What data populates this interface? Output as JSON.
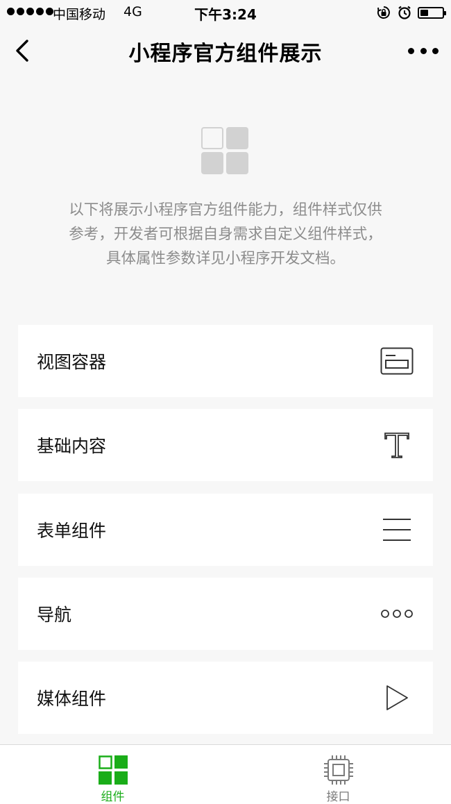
{
  "status_bar": {
    "carrier": "中国移动",
    "network": "4G",
    "time": "下午3:24",
    "battery_level": 0.35
  },
  "nav": {
    "title": "小程序官方组件展示"
  },
  "intro": {
    "lines": [
      "以下将展示小程序官方组件能力，组件样式仅供",
      "参考，开发者可根据自身需求自定义组件样式，",
      "具体属性参数详见小程序开发文档。"
    ]
  },
  "menu": {
    "items": [
      {
        "label": "视图容器",
        "icon": "view-container-icon"
      },
      {
        "label": "基础内容",
        "icon": "text-t-icon"
      },
      {
        "label": "表单组件",
        "icon": "three-lines-icon"
      },
      {
        "label": "导航",
        "icon": "three-circles-icon"
      },
      {
        "label": "媒体组件",
        "icon": "play-triangle-icon"
      }
    ]
  },
  "tab_bar": {
    "tabs": [
      {
        "label": "组件",
        "icon": "grid-icon",
        "active": true,
        "color": "#1aad19"
      },
      {
        "label": "接口",
        "icon": "chip-icon",
        "active": false,
        "color": "#7a7a7a"
      }
    ]
  }
}
